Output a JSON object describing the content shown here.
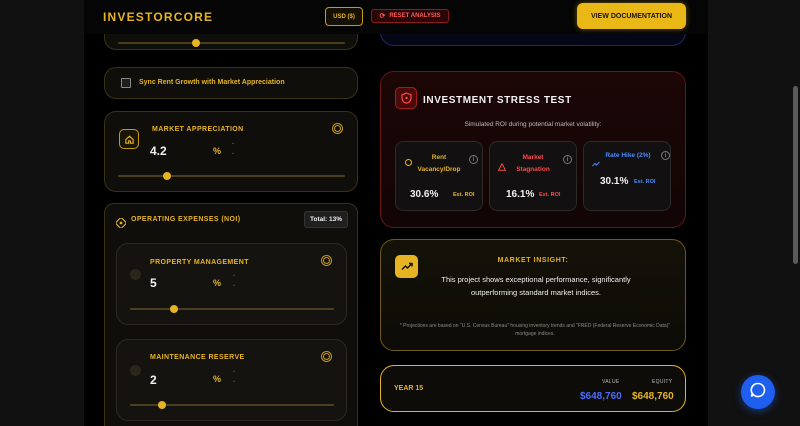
{
  "header": {
    "logo": "INVESTORCORE",
    "currency": "USD ($)",
    "reset": "RESET ANALYSIS",
    "documentation": "VIEW DOCUMENTATION"
  },
  "left": {
    "top_slider": {
      "fraction": 0.24
    },
    "sync_label": "Sync Rent Growth with Market Appreciation",
    "market_appreciation": {
      "label": "MARKET APPRECIATION",
      "value": "4.2",
      "unit": "%",
      "fraction": 0.22
    },
    "opex": {
      "label": "OPERATING EXPENSES (NOI)",
      "total": "Total: 13%",
      "property_management": {
        "label": "PROPERTY MANAGEMENT",
        "value": "5",
        "unit": "%",
        "fraction": 0.2
      },
      "maintenance_reserve": {
        "label": "MAINTENANCE RESERVE",
        "value": "2",
        "unit": "%",
        "fraction": 0.15
      }
    }
  },
  "stress": {
    "title": "INVESTMENT STRESS TEST",
    "subtitle": "Simulated ROI during potential market volatility:",
    "scenarios": [
      {
        "line1": "Rent",
        "line2": "Vacancy/Drop",
        "value": "30.6%",
        "tag": "Est. ROI",
        "color": "#e6b422"
      },
      {
        "line1": "Market",
        "line2": "Stagnation",
        "value": "16.1%",
        "tag": "Est. ROI",
        "color": "#ff4a4a"
      },
      {
        "line1": "Rate Hike (2%)",
        "line2": "",
        "value": "30.1%",
        "tag": "Est. ROI",
        "color": "#4a8aff"
      }
    ]
  },
  "insight": {
    "title": "MARKET INSIGHT:",
    "body": "This project shows exceptional performance, significantly outperforming standard market indices.",
    "note": "* Projections are based on \"U.S. Census Bureau\" housing inventory trends and \"FRED (Federal Reserve Economic Data)\" mortgage indices."
  },
  "year": {
    "label": "YEAR 15",
    "value_header": "VALUE",
    "value": "$648,760",
    "equity_header": "EQUITY",
    "equity": "$648,760"
  },
  "colors": {
    "accent": "#e6b422",
    "danger": "#ff4a4a",
    "info": "#4a8aff",
    "chat": "#1f5ff0"
  }
}
